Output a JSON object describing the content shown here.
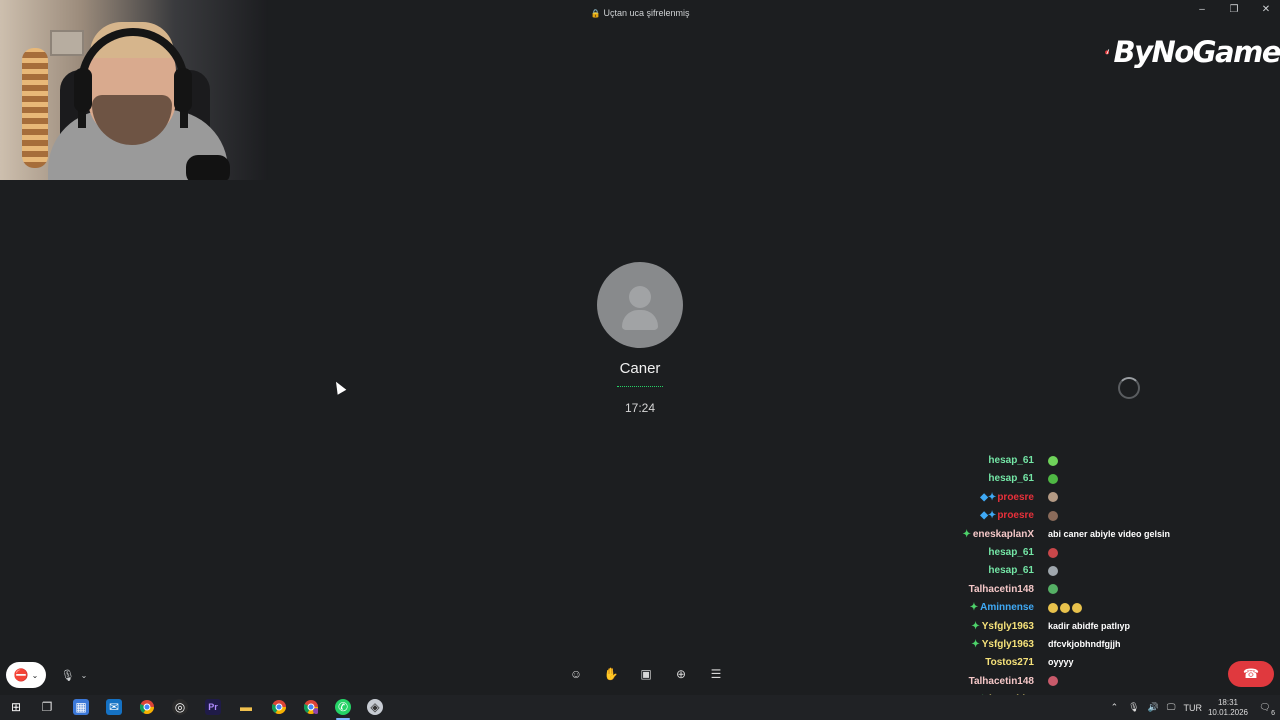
{
  "window": {
    "encryption_text": "Uçtan uca şifrelenmiş",
    "controls": [
      "–",
      "❐",
      "✕"
    ]
  },
  "overlay": {
    "logo_text": "ByNoGame",
    "brand_color": "#e8393b"
  },
  "call": {
    "contact_name": "Caner",
    "duration": "17:24",
    "status_color": "#25d366"
  },
  "chat": [
    {
      "user": "hesap_61",
      "color": "#74e6a6",
      "badges": "",
      "message": "",
      "emote_color": "#6fd35a"
    },
    {
      "user": "hesap_61",
      "color": "#74e6a6",
      "badges": "",
      "message": "",
      "emote_color": "#4fb844"
    },
    {
      "user": "proesre",
      "color": "#e8303a",
      "badges": "◆✦",
      "message": "",
      "emote_color": "#b49a84"
    },
    {
      "user": "proesre",
      "color": "#e8303a",
      "badges": "◆✦",
      "message": "",
      "emote_color": "#8a6b5a"
    },
    {
      "user": "eneskaplanX",
      "color": "#f4c7c7",
      "badges": "✦",
      "message": "abi caner abiyle video gelsin",
      "emote_color": ""
    },
    {
      "user": "hesap_61",
      "color": "#74e6a6",
      "badges": "",
      "message": "",
      "emote_color": "#c9474a"
    },
    {
      "user": "hesap_61",
      "color": "#74e6a6",
      "badges": "",
      "message": "",
      "emote_color": "#9fa7ad"
    },
    {
      "user": "Talhacetin148",
      "color": "#f4c7c7",
      "badges": "",
      "message": "",
      "emote_color": "#55b065"
    },
    {
      "user": "Aminnense",
      "color": "#3fa9f5",
      "badges": "✦",
      "message": "",
      "emote_color": "#e8c24c",
      "emote_count": 3
    },
    {
      "user": "Ysfgly1963",
      "color": "#f6e27a",
      "badges": "✦",
      "message": "kadir abidfe patlıyp",
      "emote_color": ""
    },
    {
      "user": "Ysfgly1963",
      "color": "#f6e27a",
      "badges": "✦",
      "message": "dfcvkjobhndfgjjh",
      "emote_color": ""
    },
    {
      "user": "Tostos271",
      "color": "#f6e27a",
      "badges": "",
      "message": "oyyyy",
      "emote_color": ""
    },
    {
      "user": "Talhacetin148",
      "color": "#f4c7c7",
      "badges": "",
      "message": "",
      "emote_color": "#c85a6a"
    },
    {
      "user": "boraabim",
      "color": "#f6e27a",
      "badges": "✦",
      "message": "it kudurdu",
      "emote_color": ""
    }
  ],
  "controls": {
    "camera_icon": "camera-off-icon",
    "mic_icon": "microphone-icon",
    "mid_icons": [
      "emoji-icon",
      "raise-hand-icon",
      "screen-share-icon",
      "add-participant-icon",
      "more-options-icon"
    ],
    "end_call_icon": "end-call-icon",
    "end_call_color": "#e0393e"
  },
  "taskbar": {
    "icons": [
      "windows-start-icon",
      "task-view-icon",
      "store-icon",
      "outlook-icon",
      "chrome-icon",
      "obs-icon",
      "premiere-icon",
      "file-explorer-icon",
      "chrome-alt-icon",
      "chrome-profile-icon",
      "whatsapp-icon",
      "app-icon"
    ],
    "language": "TUR",
    "time": "18:31",
    "date": "10.01.2026",
    "notification_count": "6"
  }
}
